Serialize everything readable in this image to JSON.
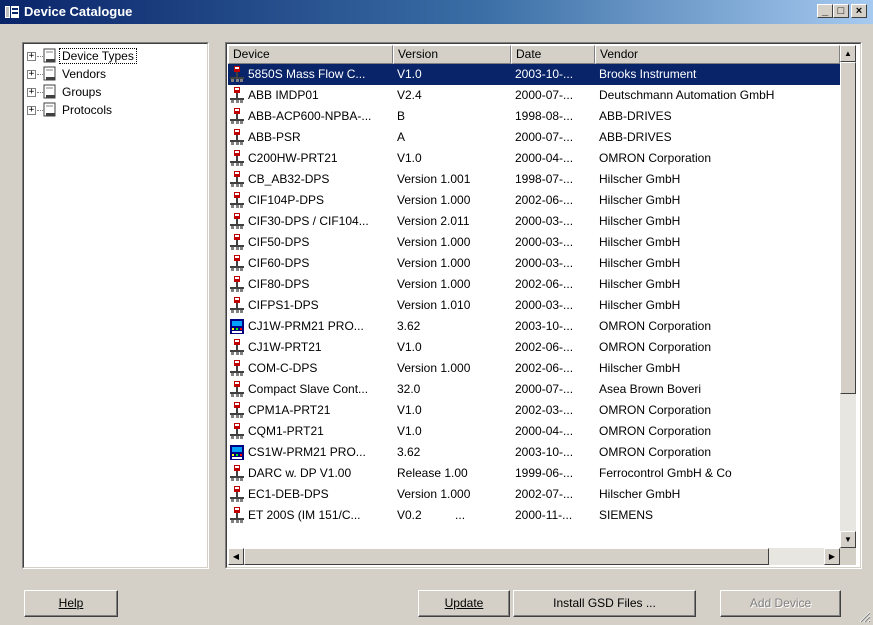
{
  "window": {
    "title": "Device Catalogue"
  },
  "tree": {
    "items": [
      {
        "label": "Device Types",
        "selected": true
      },
      {
        "label": "Vendors",
        "selected": false
      },
      {
        "label": "Groups",
        "selected": false
      },
      {
        "label": "Protocols",
        "selected": false
      }
    ]
  },
  "list": {
    "columns": [
      "Device",
      "Version",
      "Date",
      "Vendor"
    ],
    "rows": [
      {
        "device": "5850S Mass Flow C...",
        "version": "V1.0",
        "date": "2003-10-...",
        "vendor": "Brooks Instrument",
        "icon": "slave-device-icon",
        "selected": true
      },
      {
        "device": "ABB IMDP01",
        "version": "V2.4",
        "date": "2000-07-...",
        "vendor": "Deutschmann Automation GmbH",
        "icon": "slave-device-icon"
      },
      {
        "device": "ABB-ACP600-NPBA-...",
        "version": "B",
        "date": "1998-08-...",
        "vendor": "ABB-DRIVES",
        "icon": "slave-device-icon"
      },
      {
        "device": "ABB-PSR",
        "version": "A",
        "date": "2000-07-...",
        "vendor": "ABB-DRIVES",
        "icon": "slave-device-icon"
      },
      {
        "device": "C200HW-PRT21",
        "version": "V1.0",
        "date": "2000-04-...",
        "vendor": "OMRON Corporation",
        "icon": "slave-device-icon"
      },
      {
        "device": "CB_AB32-DPS",
        "version": "Version 1.001",
        "date": "1998-07-...",
        "vendor": "Hilscher GmbH",
        "icon": "slave-device-icon"
      },
      {
        "device": "CIF104P-DPS",
        "version": "Version 1.000",
        "date": "2002-06-...",
        "vendor": "Hilscher GmbH",
        "icon": "slave-device-icon"
      },
      {
        "device": "CIF30-DPS / CIF104...",
        "version": "Version 2.011",
        "date": "2000-03-...",
        "vendor": "Hilscher GmbH",
        "icon": "slave-device-icon"
      },
      {
        "device": "CIF50-DPS",
        "version": "Version 1.000",
        "date": "2000-03-...",
        "vendor": "Hilscher GmbH",
        "icon": "slave-device-icon"
      },
      {
        "device": "CIF60-DPS",
        "version": "Version 1.000",
        "date": "2000-03-...",
        "vendor": "Hilscher GmbH",
        "icon": "slave-device-icon"
      },
      {
        "device": "CIF80-DPS",
        "version": "Version 1.000",
        "date": "2002-06-...",
        "vendor": "Hilscher GmbH",
        "icon": "slave-device-icon"
      },
      {
        "device": "CIFPS1-DPS",
        "version": "Version 1.010",
        "date": "2000-03-...",
        "vendor": "Hilscher GmbH",
        "icon": "slave-device-icon"
      },
      {
        "device": "CJ1W-PRM21 PRO...",
        "version": "3.62",
        "date": "2003-10-...",
        "vendor": "OMRON Corporation",
        "icon": "master-device-icon"
      },
      {
        "device": "CJ1W-PRT21",
        "version": "V1.0",
        "date": "2002-06-...",
        "vendor": "OMRON Corporation",
        "icon": "slave-device-icon"
      },
      {
        "device": "COM-C-DPS",
        "version": "Version 1.000",
        "date": "2002-06-...",
        "vendor": "Hilscher GmbH",
        "icon": "slave-device-icon"
      },
      {
        "device": "Compact Slave Cont...",
        "version": "32.0",
        "date": "2000-07-...",
        "vendor": "Asea Brown Boveri",
        "icon": "slave-device-icon"
      },
      {
        "device": "CPM1A-PRT21",
        "version": "V1.0",
        "date": "2002-03-...",
        "vendor": "OMRON Corporation",
        "icon": "slave-device-icon"
      },
      {
        "device": "CQM1-PRT21",
        "version": "V1.0",
        "date": "2000-04-...",
        "vendor": "OMRON Corporation",
        "icon": "slave-device-icon"
      },
      {
        "device": "CS1W-PRM21 PRO...",
        "version": "3.62",
        "date": "2003-10-...",
        "vendor": "OMRON Corporation",
        "icon": "master-device-icon"
      },
      {
        "device": "DARC w. DP V1.00",
        "version": "Release 1.00",
        "date": "1999-06-...",
        "vendor": "Ferrocontrol GmbH & Co",
        "icon": "slave-device-icon"
      },
      {
        "device": "EC1-DEB-DPS",
        "version": "Version 1.000",
        "date": "2002-07-...",
        "vendor": "Hilscher GmbH",
        "icon": "slave-device-icon"
      },
      {
        "device": "ET 200S (IM 151/C...",
        "version": "V0.2          ...",
        "date": "2000-11-...",
        "vendor": "SIEMENS",
        "icon": "slave-device-icon"
      }
    ]
  },
  "buttons": {
    "help": "Help",
    "update": "Update",
    "install": "Install GSD Files ...",
    "add_device": "Add Device"
  },
  "colors": {
    "selection": "#0a246a",
    "face": "#d4d0c8"
  }
}
